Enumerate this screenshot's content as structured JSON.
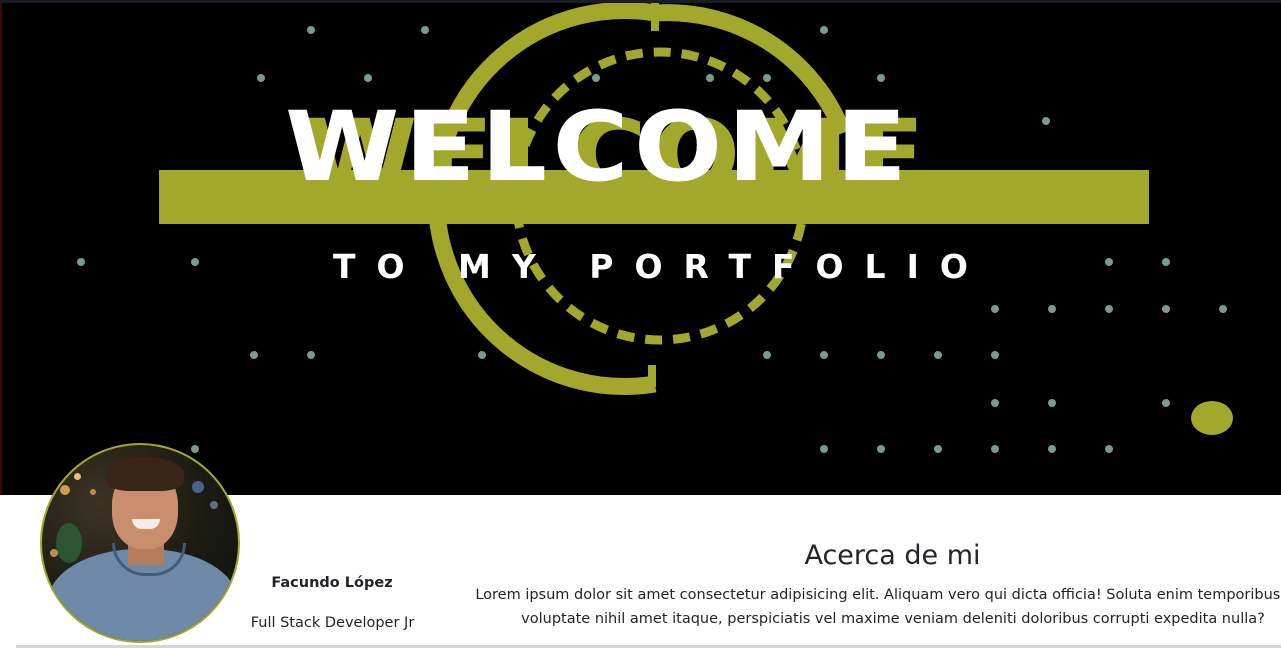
{
  "banner": {
    "welcome": "WELCOME",
    "subtitle": "TO MY PORTFOLIO",
    "colors": {
      "background": "#000000",
      "accent": "#a2a82b",
      "dots": "#7a9a8a",
      "text": "#ffffff"
    }
  },
  "profile": {
    "avatar_icon": "profile-photo",
    "name": "Facundo López",
    "role": "Full Stack Developer Jr"
  },
  "about": {
    "title": "Acerca de mi",
    "text": "Lorem ipsum dolor sit amet consectetur adipisicing elit. Aliquam vero qui dicta officia! Soluta enim temporibus sed voluptate nihil amet itaque, perspiciatis vel maxime veniam deleniti doloribus corrupti expedita nulla?"
  }
}
